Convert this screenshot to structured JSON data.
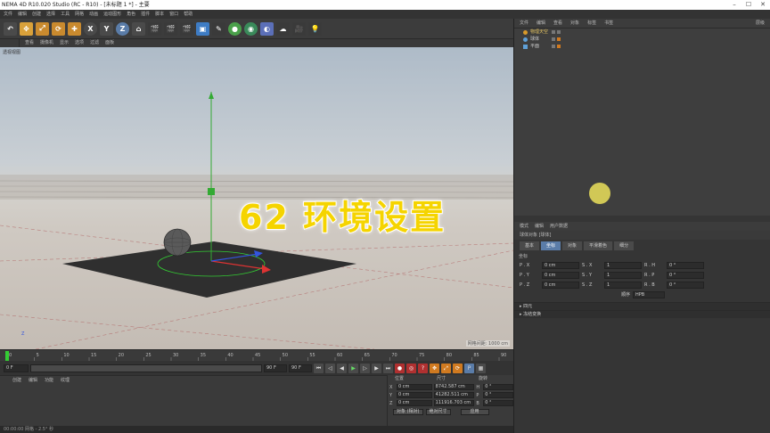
{
  "window": {
    "title": "NEMA 4D R10.020 Studio (RC - R10) - [未标题 1 *] - 主要",
    "controls": [
      "–",
      "☐",
      "✕"
    ]
  },
  "menubar": [
    "文件",
    "编辑",
    "创建",
    "选择",
    "工具",
    "网格",
    "动画",
    "运动图形",
    "角色",
    "插件",
    "脚本",
    "窗口",
    "帮助"
  ],
  "toolbar": {
    "buttons": [
      "undo-icon",
      "move-tool",
      "scale-tool",
      "rotate-tool",
      "select-tool",
      "axis-x",
      "axis-y",
      "axis-z",
      "world-coord",
      "render-view",
      "render-picture",
      "render-settings",
      "cube-object",
      "pen-tool",
      "subdivision",
      "array",
      "deformer",
      "environment",
      "camera",
      "light"
    ],
    "axis_labels": [
      "X",
      "Y",
      "Z"
    ]
  },
  "viewport": {
    "menu": [
      "查看",
      "摄像机",
      "显示",
      "选项",
      "过滤",
      "面板"
    ],
    "label": "透视视图",
    "scale_text": "网格间距: 1000 cm",
    "axis_hint": "Z"
  },
  "overlay": {
    "title": "62 环境设置"
  },
  "object_manager": {
    "menu": [
      "文件",
      "编辑",
      "查看",
      "对象",
      "标签",
      "书签"
    ],
    "search_label": "层级",
    "objects": [
      {
        "name": "物理天空"
      },
      {
        "name": "球体"
      },
      {
        "name": "平面"
      }
    ]
  },
  "attributes": {
    "menu": [
      "模式",
      "编辑",
      "用户数据"
    ],
    "header": "球体对象 [球体]",
    "tabs": [
      "基本",
      "坐标",
      "对象",
      "平滑着色",
      "(Phong)"
    ],
    "tabs_display": [
      "基本",
      "坐标",
      "对象",
      "平滑着色",
      "细分"
    ],
    "section": "坐标",
    "rows": [
      {
        "a": "P . X",
        "v1": "0 cm",
        "b": "S . X",
        "v2": "1",
        "c": "R . H",
        "v3": "0 °"
      },
      {
        "a": "P . Y",
        "v1": "0 cm",
        "b": "S . Y",
        "v2": "1",
        "c": "R . P",
        "v3": "0 °"
      },
      {
        "a": "P . Z",
        "v1": "0 cm",
        "b": "S . Z",
        "v2": "1",
        "c": "R . B",
        "v3": "0 °"
      }
    ],
    "order_label": "顺序",
    "order_value": "HPB",
    "sections": [
      "四元",
      "冻结变换"
    ]
  },
  "timeline": {
    "ticks": [
      "0",
      "5",
      "10",
      "15",
      "20",
      "25",
      "30",
      "35",
      "40",
      "45",
      "50",
      "55",
      "60",
      "65",
      "70",
      "75",
      "80",
      "85",
      "90"
    ],
    "start_field": "0 F",
    "end_field": "90 F",
    "current_field": "90 F"
  },
  "material_manager": {
    "menu": [
      "创建",
      "编辑",
      "功能",
      "纹理"
    ]
  },
  "coordinates": {
    "headers": [
      "位置",
      "尺寸",
      "旋转"
    ],
    "rows": [
      {
        "axis": "X",
        "pos": "0 cm",
        "size": "8742.587 cm",
        "rot_axis": "H",
        "rot": "0 °"
      },
      {
        "axis": "Y",
        "pos": "0 cm",
        "size": "41282.511 cm",
        "rot_axis": "P",
        "rot": "0 °"
      },
      {
        "axis": "Z",
        "pos": "0 cm",
        "size": "111916.703 cm",
        "rot_axis": "B",
        "rot": "0 °"
      }
    ],
    "mode": "对象 (相对)",
    "size_mode": "绝对尺寸",
    "apply": "应用"
  },
  "statusbar": {
    "text": "00:00:00 网格 - 2.5° 秒"
  },
  "colors": {
    "accent_yellow": "#f5d400",
    "tab_active": "#5a7ca8",
    "record_red": "#b03030"
  }
}
